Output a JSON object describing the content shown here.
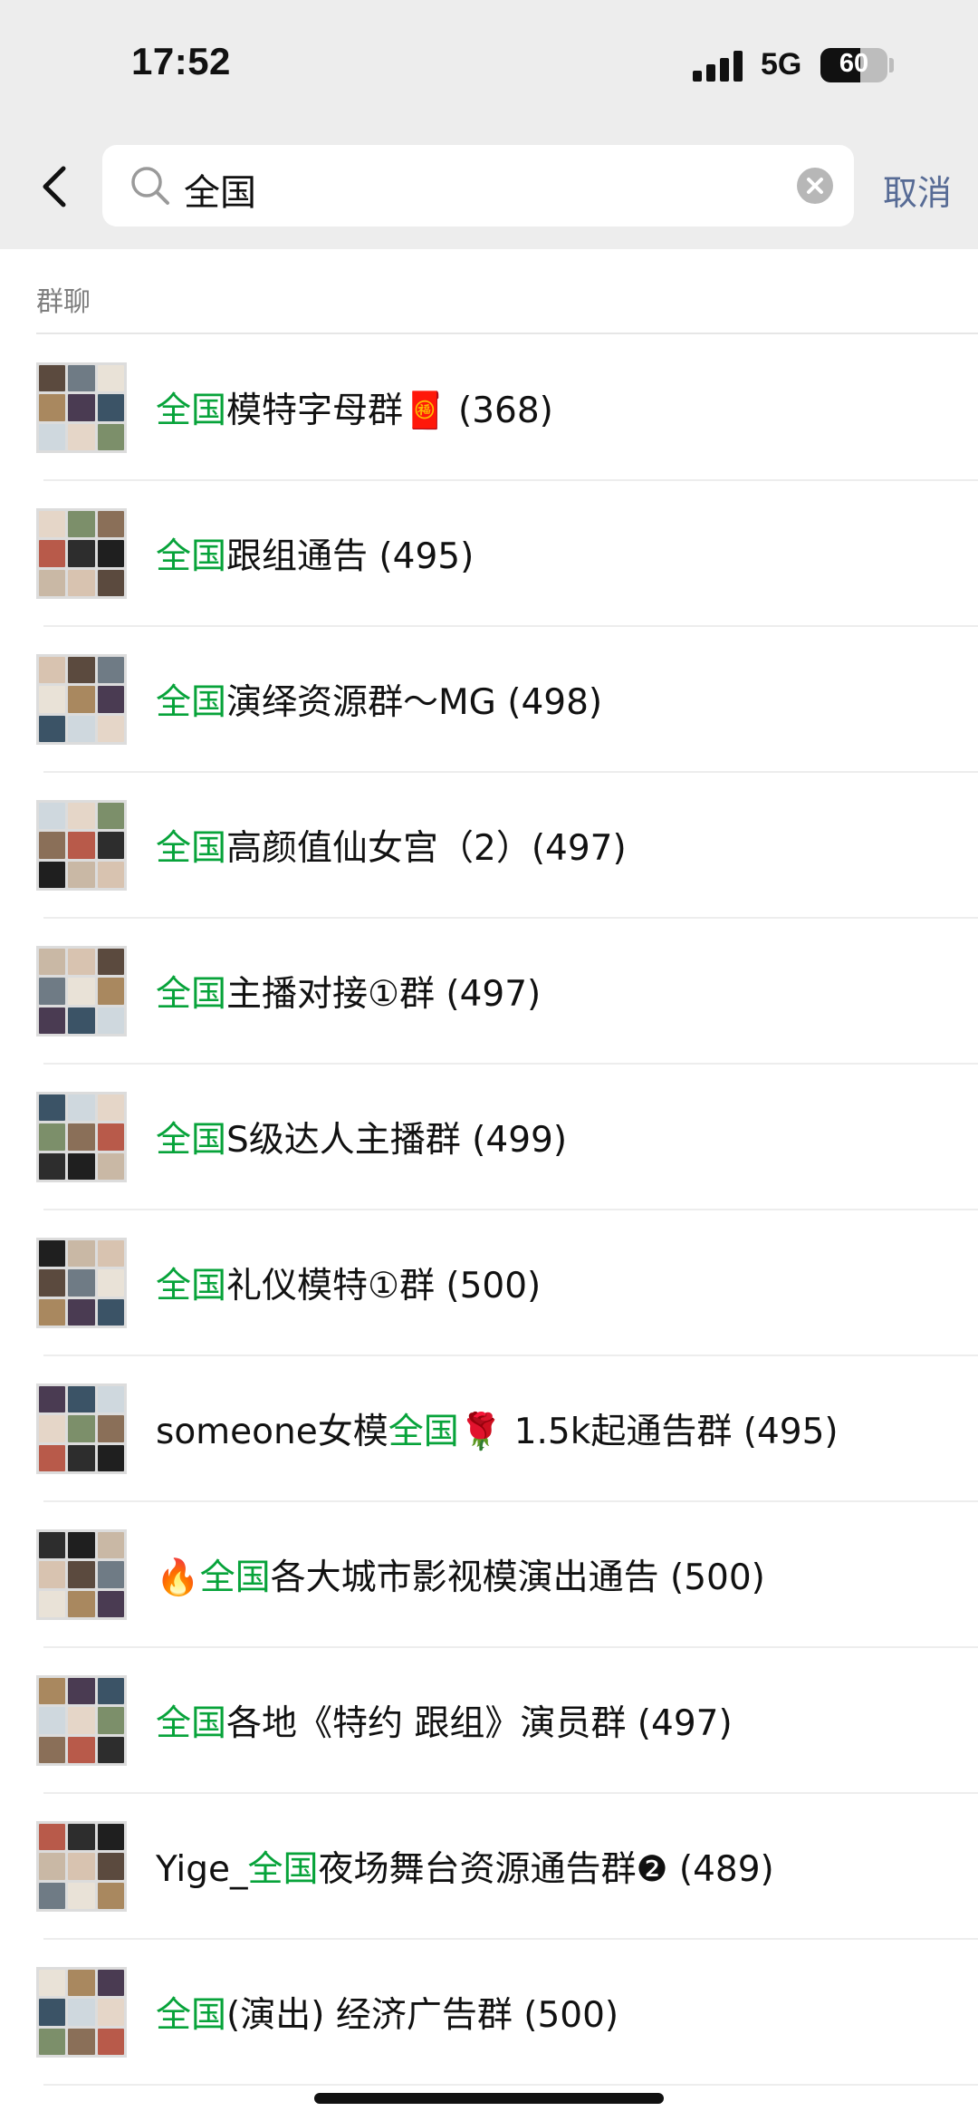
{
  "status_bar": {
    "time": "17:52",
    "network": "5G",
    "battery": "60",
    "battery_level": 0.6
  },
  "search": {
    "query": "全国",
    "cancel_label": "取消"
  },
  "section": {
    "title": "群聊"
  },
  "results": [
    {
      "pre": "",
      "hl": "全国",
      "post": "模特字母群🧧 (368)"
    },
    {
      "pre": "",
      "hl": "全国",
      "post": "跟组通告 (495)"
    },
    {
      "pre": "",
      "hl": "全国",
      "post": "演绎资源群～MG (498)"
    },
    {
      "pre": "",
      "hl": "全国",
      "post": "高颜值仙女宫（2）(497)"
    },
    {
      "pre": "",
      "hl": "全国",
      "post": "主播对接①群 (497)"
    },
    {
      "pre": "",
      "hl": "全国",
      "post": "S级达人主播群 (499)"
    },
    {
      "pre": "",
      "hl": "全国",
      "post": "礼仪模特①群 (500)"
    },
    {
      "pre": "someone女模",
      "hl": "全国",
      "post": "🌹 1.5k起通告群 (495)"
    },
    {
      "pre": "🔥",
      "hl": "全国",
      "post": "各大城市影视模演出通告 (500)"
    },
    {
      "pre": "",
      "hl": "全国",
      "post": "各地《特约 跟组》演员群 (497)"
    },
    {
      "pre": "Yige_",
      "hl": "全国",
      "post": "夜场舞台资源通告群❷ (489)"
    },
    {
      "pre": "",
      "hl": "全国",
      "post": "(演出) 经济广告群 (500)"
    }
  ],
  "colors": {
    "highlight": "#07a33a",
    "cancel": "#576b95",
    "header_bg": "#ededed"
  }
}
